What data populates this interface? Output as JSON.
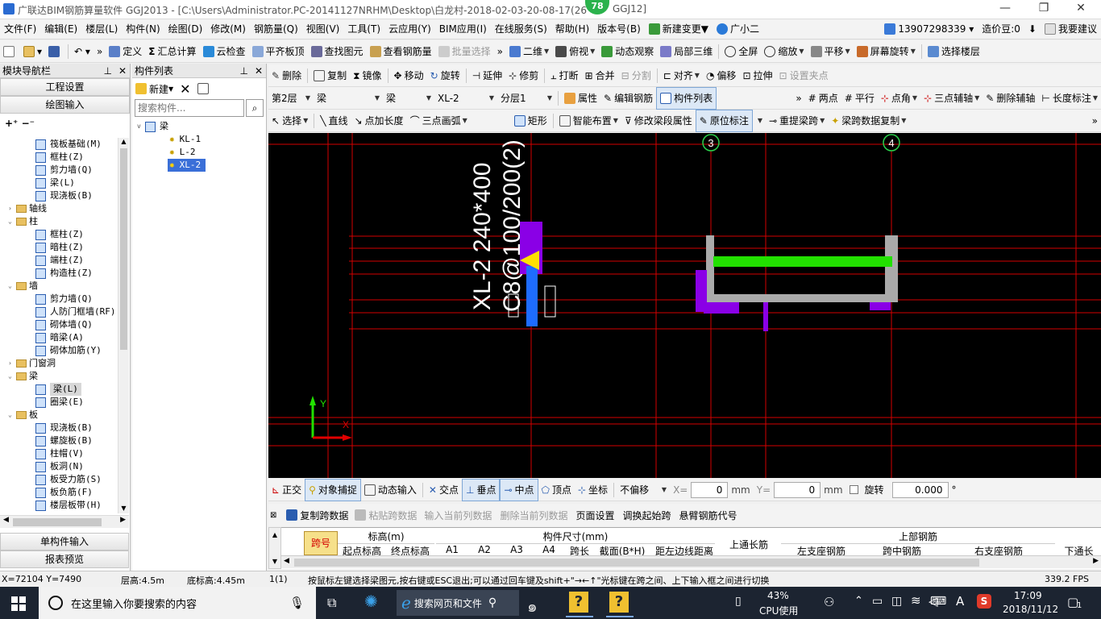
{
  "window": {
    "title": "广联达BIM钢筋算量软件 GGJ2013 - [C:\\Users\\Administrator.PC-20141127NRHM\\Desktop\\白龙村-2018-02-03-20-08-17(26",
    "title_tail": "GGJ12]",
    "badge": "78"
  },
  "menu": [
    "文件(F)",
    "编辑(E)",
    "楼层(L)",
    "构件(N)",
    "绘图(D)",
    "修改(M)",
    "钢筋量(Q)",
    "视图(V)",
    "工具(T)",
    "云应用(Y)",
    "BIM应用(I)",
    "在线服务(S)",
    "帮助(H)",
    "版本号(B)",
    "新建变更",
    "广小二"
  ],
  "account": {
    "phone": "13907298339",
    "bean": "造价豆:0",
    "suggest": "我要建议"
  },
  "toolbar1": [
    "定义",
    "汇总计算",
    "云检查",
    "平齐板顶",
    "查找图元",
    "查看钢筋量",
    "批量选择"
  ],
  "toolbar1_right": [
    "二维",
    "俯视",
    "动态观察",
    "局部三维",
    "全屏",
    "缩放",
    "平移",
    "屏幕旋转",
    "选择楼层"
  ],
  "toolbar2": [
    "删除",
    "复制",
    "镜像",
    "移动",
    "旋转",
    "延伸",
    "修剪",
    "打断",
    "合并",
    "分割",
    "对齐",
    "偏移",
    "拉伸",
    "设置夹点"
  ],
  "toolbar3": {
    "floor": "第2层",
    "type1": "梁",
    "type2": "梁",
    "component": "XL-2",
    "layer": "分层1",
    "buttons": [
      "属性",
      "编辑钢筋",
      "构件列表"
    ],
    "right": [
      "两点",
      "平行",
      "点角",
      "三点辅轴",
      "删除辅轴",
      "长度标注"
    ]
  },
  "toolbar4": [
    "选择",
    "直线",
    "点加长度",
    "三点画弧",
    "矩形",
    "智能布置",
    "修改梁段属性",
    "原位标注",
    "重提梁跨",
    "梁跨数据复制"
  ],
  "left_panel": {
    "title": "模块导航栏",
    "buttons": [
      "工程设置",
      "绘图输入"
    ],
    "bottom_buttons": [
      "单构件输入",
      "报表预览"
    ],
    "tree": [
      {
        "level": 2,
        "label": "筏板基础(M)"
      },
      {
        "level": 2,
        "label": "框柱(Z)"
      },
      {
        "level": 2,
        "label": "剪力墙(Q)"
      },
      {
        "level": 2,
        "label": "梁(L)"
      },
      {
        "level": 2,
        "label": "现浇板(B)"
      },
      {
        "level": 1,
        "label": "轴线",
        "folder": true,
        "toggle": ">"
      },
      {
        "level": 1,
        "label": "柱",
        "folder": true,
        "toggle": "v"
      },
      {
        "level": 2,
        "label": "框柱(Z)"
      },
      {
        "level": 2,
        "label": "暗柱(Z)"
      },
      {
        "level": 2,
        "label": "端柱(Z)"
      },
      {
        "level": 2,
        "label": "构造柱(Z)"
      },
      {
        "level": 1,
        "label": "墙",
        "folder": true,
        "toggle": "v"
      },
      {
        "level": 2,
        "label": "剪力墙(Q)"
      },
      {
        "level": 2,
        "label": "人防门框墙(RF)"
      },
      {
        "level": 2,
        "label": "砌体墙(Q)"
      },
      {
        "level": 2,
        "label": "暗梁(A)"
      },
      {
        "level": 2,
        "label": "砌体加筋(Y)"
      },
      {
        "level": 1,
        "label": "门窗洞",
        "folder": true,
        "toggle": ">"
      },
      {
        "level": 1,
        "label": "梁",
        "folder": true,
        "toggle": "v"
      },
      {
        "level": 2,
        "label": "梁(L)",
        "selected": true
      },
      {
        "level": 2,
        "label": "圈梁(E)"
      },
      {
        "level": 1,
        "label": "板",
        "folder": true,
        "toggle": "v"
      },
      {
        "level": 2,
        "label": "现浇板(B)"
      },
      {
        "level": 2,
        "label": "螺旋板(B)"
      },
      {
        "level": 2,
        "label": "柱帽(V)"
      },
      {
        "level": 2,
        "label": "板洞(N)"
      },
      {
        "level": 2,
        "label": "板受力筋(S)"
      },
      {
        "level": 2,
        "label": "板负筋(F)"
      },
      {
        "level": 2,
        "label": "楼层板带(H)"
      }
    ]
  },
  "component_list": {
    "title": "构件列表",
    "new_label": "新建",
    "search_placeholder": "搜索构件...",
    "root": "梁",
    "items": [
      "KL-1",
      "L-2",
      "XL-2"
    ],
    "selected": "XL-2"
  },
  "canvas": {
    "annotation1": "XL-2  240*400",
    "annotation2": "C8@100/200(2)",
    "axis_labels": [
      "3",
      "4"
    ],
    "ucs_y": "Y",
    "ucs_x": "X"
  },
  "snap_bar": {
    "items": [
      "正交",
      "对象捕捉",
      "动态输入",
      "交点",
      "垂点",
      "中点",
      "顶点",
      "坐标"
    ],
    "offset_mode": "不偏移",
    "x_label": "X=",
    "x_value": "0",
    "unit": "mm",
    "y_label": "Y=",
    "y_value": "0",
    "rotate_label": "旋转",
    "rotate_value": "0.000",
    "deg": "°"
  },
  "grid_toolbar": [
    "复制跨数据",
    "粘贴跨数据",
    "输入当前列数据",
    "删除当前列数据",
    "页面设置",
    "调换起始跨",
    "悬臂钢筋代号"
  ],
  "grid_headers": {
    "span": "跨号",
    "elev": "标高(m)",
    "elev_start": "起点标高",
    "elev_end": "终点标高",
    "size": "构件尺寸(mm)",
    "a1": "A1",
    "a2": "A2",
    "a3": "A3",
    "a4": "A4",
    "span_len": "跨长",
    "section": "截面(B*H)",
    "dist": "距左边线距离",
    "top_long": "上通长筋",
    "top_bar": "上部钢筋",
    "left_support": "左支座钢筋",
    "mid": "跨中钢筋",
    "right_support": "右支座钢筋",
    "bottom_long": "下通长"
  },
  "status": {
    "coords": "X=72104 Y=7490",
    "floor_height": "层高:4.5m",
    "bottom_elev": "底标高:4.45m",
    "count": "1(1)",
    "hint": "按鼠标左键选择梁图元,按右键或ESC退出;可以通过回车键及shift+\"→←↑\"光标键在跨之间、上下输入框之间进行切换",
    "fps": "339.2 FPS"
  },
  "taskbar": {
    "search_placeholder": "在这里输入你要搜索的内容",
    "browser": "搜索网页和文件",
    "cpu_pct": "43%",
    "cpu_label": "CPU使用",
    "ime": "A",
    "time": "17:09",
    "date": "2018/11/12",
    "notif": "1"
  },
  "colors": {
    "canvas_bg": "#000000",
    "grid_line": "#d40000",
    "beam_green": "#22e000",
    "magenta": "#8a00e6",
    "blue": "#1e6cff",
    "yellow": "#ffe000"
  }
}
